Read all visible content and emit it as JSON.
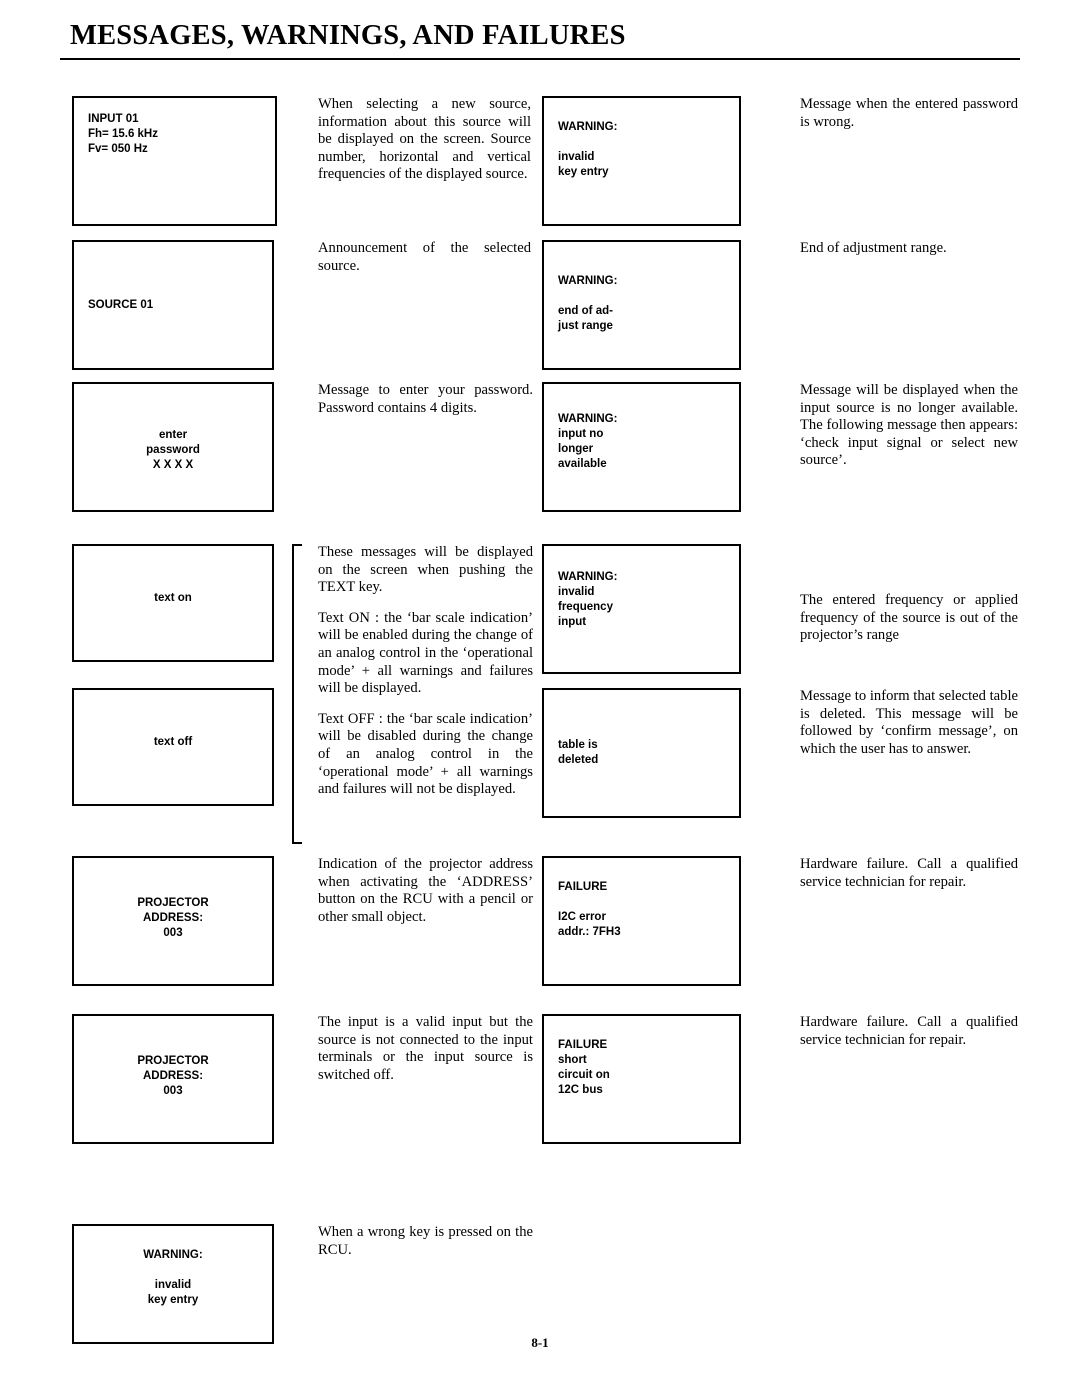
{
  "document": {
    "title": "MESSAGES, WARNINGS, AND FAILURES",
    "page_number": "8-1"
  },
  "boxes": {
    "input01": "INPUT 01\nFh= 15.6 kHz\nFv= 050 Hz",
    "source01": "SOURCE 01",
    "enter_password": "enter\npassword\nX X X X",
    "text_on": "text on",
    "text_off": "text off",
    "projector_address_1": "PROJECTOR\nADDRESS:\n003",
    "projector_address_2": "PROJECTOR\nADDRESS:\n003",
    "warning_invalid_key_bottom": "WARNING:\n\ninvalid\nkey entry",
    "warning_invalid_key_top": "WARNING:\n\ninvalid\nkey entry",
    "warning_end_of_adjust": "WARNING:\n\nend of ad-\njust range",
    "warning_input_no_longer": "WARNING:\ninput no\nlonger\navailable",
    "warning_invalid_frequency": "WARNING:\ninvalid\nfrequency\ninput",
    "table_is_deleted": "table is\ndeleted",
    "failure_i2c_error": "FAILURE\n\nI2C  error\naddr.: 7FH3",
    "failure_short_circuit": "FAILURE\nshort\ncircuit on\n12C bus"
  },
  "descriptions": {
    "col2": {
      "new_source": "When selecting a new source, information about this source will be displayed on the screen. Source number, horizontal and vertical frequencies of the displayed source.",
      "announcement": "Announcement of the selected source.",
      "password": "Message to enter your password. Password contains 4 digits.",
      "text_intro": "These messages will be displayed on the screen when pushing the TEXT key.",
      "text_on": "Text ON : the ‘bar scale indication’ will be enabled during the change of an analog control in the ‘operational mode’ + all warnings and failures will be displayed.",
      "text_off": "Text OFF : the ‘bar scale indication’ will be disabled during the change of an analog control in the ‘operational mode’ + all warnings and failures will not be displayed.",
      "projector_address": "Indication of the projector address when activating the ‘ADDRESS’ button on the RCU with a pencil or other small object.",
      "valid_input": "The input is a valid input but the source is not connected to the input terminals or the input source is switched off.",
      "wrong_key": "When a wrong key is pressed on the RCU."
    },
    "col4": {
      "password_wrong": "Message when the entered password is wrong.",
      "end_of_range": "End of adjustment range.",
      "input_no_longer": "Message will be displayed when the input source is no longer available. The following message then appears: ‘check input signal or select new source’.",
      "out_of_range": "The entered frequency or applied frequency of the source is out of the projector’s range",
      "table_deleted": "Message to inform that selected table is deleted. This message will be followed by ‘confirm message’, on which the user has to answer.",
      "hardware_failure_1": "Hardware failure. Call a qualified service technician for repair.",
      "hardware_failure_2": "Hardware failure. Call a qualified service technician for repair."
    }
  }
}
